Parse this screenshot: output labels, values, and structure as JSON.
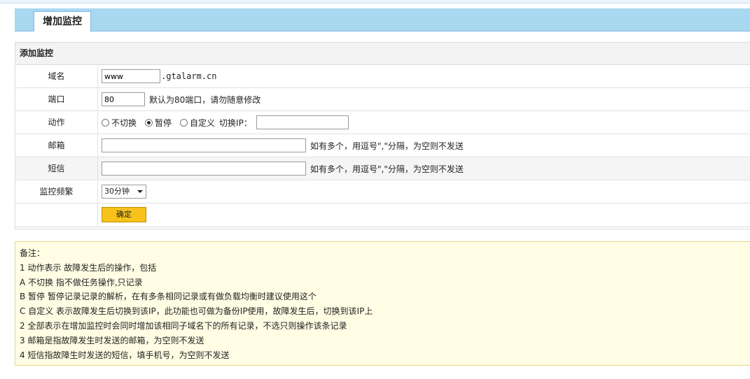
{
  "tab": {
    "label": "增加监控"
  },
  "panel": {
    "title": "添加监控"
  },
  "form": {
    "domain": {
      "label": "域名",
      "value": "www",
      "suffix": ".gtalarm.cn"
    },
    "port": {
      "label": "端口",
      "value": "80",
      "hint": "默认为80端口，请勿随意修改"
    },
    "action": {
      "label": "动作",
      "options": [
        "不切换",
        "暂停",
        "自定义"
      ],
      "selected": "暂停",
      "ip_label": "切换IP：",
      "ip_value": ""
    },
    "email": {
      "label": "邮箱",
      "value": "",
      "hint": "如有多个，用逗号\",\"分隔，为空则不发送"
    },
    "sms": {
      "label": "短信",
      "value": "",
      "hint": "如有多个，用逗号\",\"分隔，为空则不发送"
    },
    "frequency": {
      "label": "监控频繁",
      "value": "30分钟"
    },
    "submit_label": "确定"
  },
  "notes": {
    "title": "备注：",
    "lines": [
      "1 动作表示 故障发生后的操作，包括",
      "A 不切换 指不做任务操作,只记录",
      "B 暂停 暂停记录记录的解析，在有多条相同记录或有做负载均衡时建议使用这个",
      "C 自定义 表示故障发生后切换到该IP，此功能也可做为备份IP使用，故障发生后，切换到该IP上",
      "2 全部表示在增加监控时会同时增加该相同子域名下的所有记录，不选只则操作该条记录",
      "3 邮箱是指故障发生时发送的邮箱，为空则不发送",
      "4 短信指故障生时发送的短信，填手机号，为空则不发送"
    ]
  },
  "colors": {
    "tabbar": "#a9d8f1",
    "submit": "#f7c21a",
    "notes_bg": "#fffde4"
  }
}
